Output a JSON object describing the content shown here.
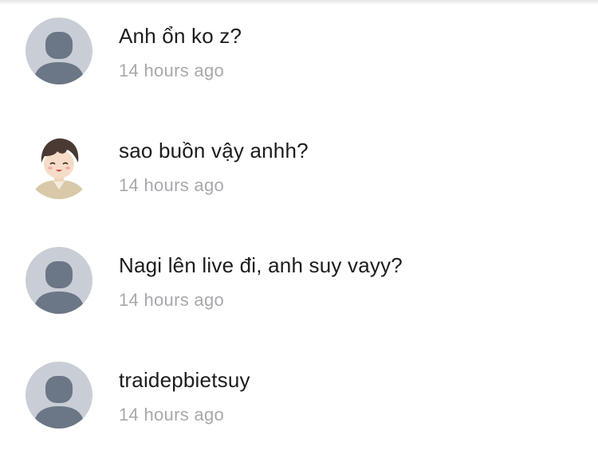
{
  "comments": [
    {
      "text": "Anh ổn ko z?",
      "time": "14 hours ago",
      "avatar": "default-avatar-icon"
    },
    {
      "text": "sao buồn vậy anhh?",
      "time": "14 hours ago",
      "avatar": "anime-boy-avatar"
    },
    {
      "text": "Nagi lên live đi, anh suy vayy?",
      "time": "14 hours ago",
      "avatar": "default-avatar-icon"
    },
    {
      "text": "traidepbietsuy",
      "time": "14 hours ago",
      "avatar": "default-avatar-icon"
    }
  ],
  "colors": {
    "avatar_bg": "#c9ced6",
    "avatar_fg": "#6b7686",
    "text": "#1c1c1e",
    "time": "#a8a8ad"
  }
}
